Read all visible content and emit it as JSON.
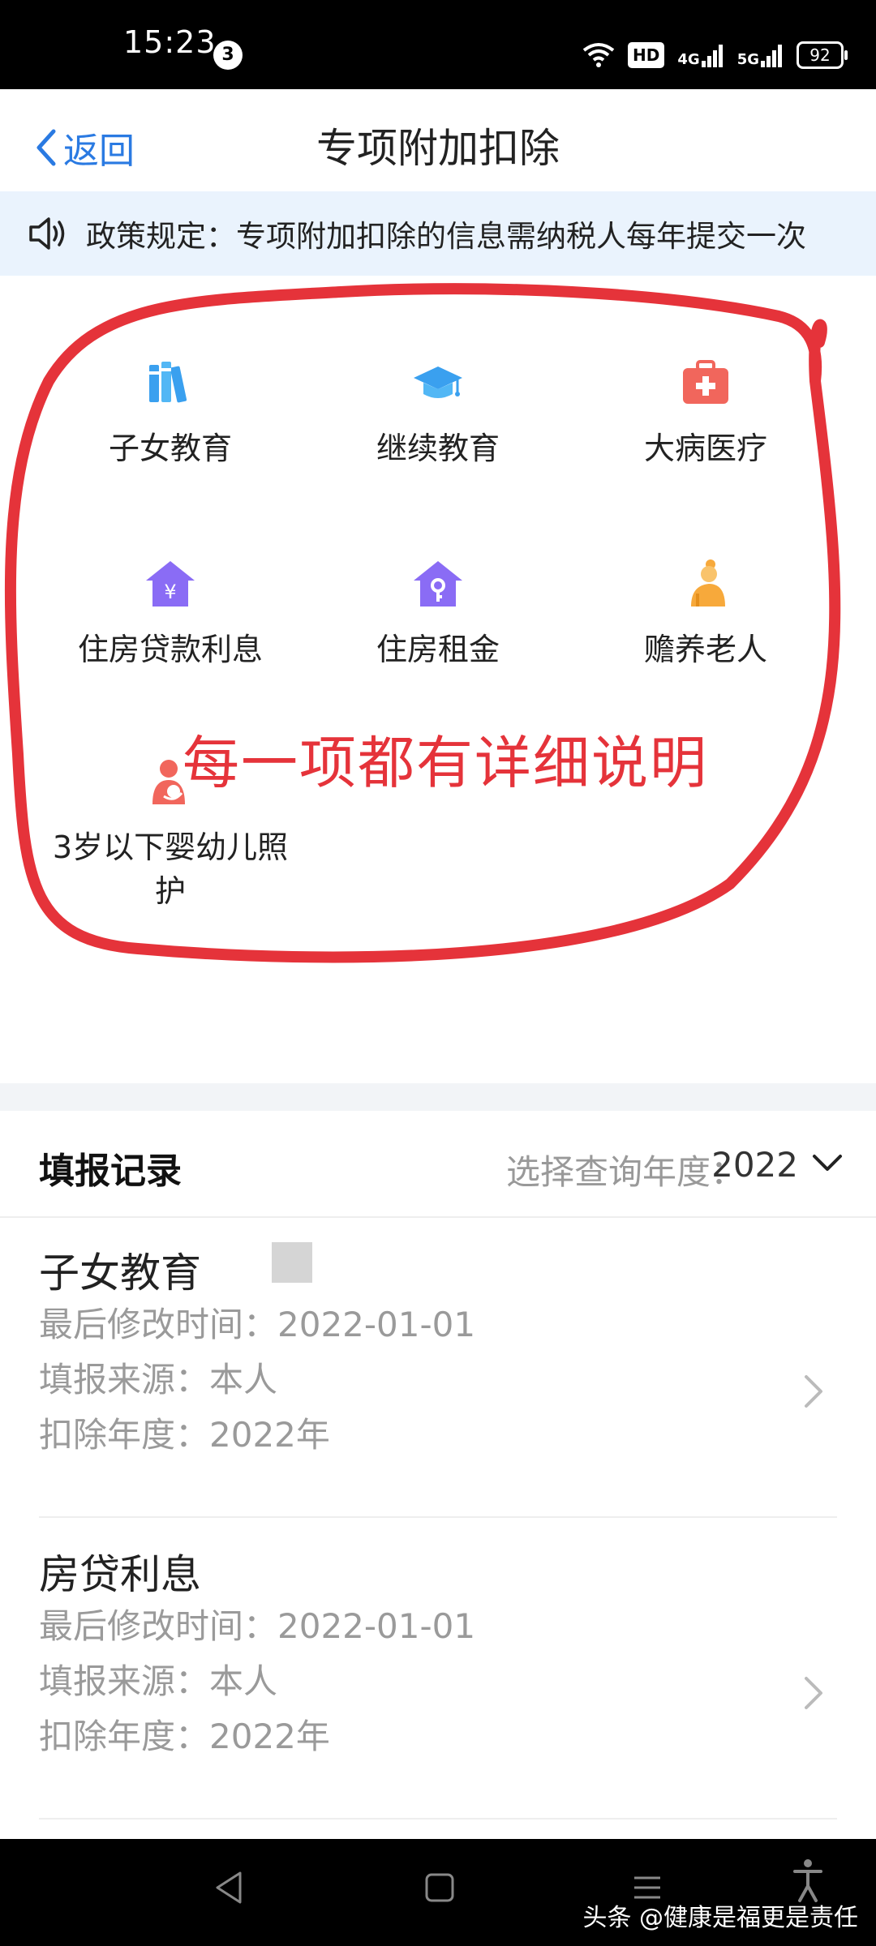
{
  "status_bar": {
    "time": "15:23",
    "notification_count": "3",
    "hd_label": "HD",
    "net1": "4G",
    "net2": "5G",
    "battery": "92"
  },
  "header": {
    "back_label": "返回",
    "title": "专项附加扣除"
  },
  "notice": {
    "text": "政策规定：专项附加扣除的信息需纳税人每年提交一次"
  },
  "categories": [
    {
      "label": "子女教育",
      "icon": "books-icon",
      "color": "#3aa0ef"
    },
    {
      "label": "继续教育",
      "icon": "graduation-cap-icon",
      "color": "#3aa0ef"
    },
    {
      "label": "大病医疗",
      "icon": "medical-kit-icon",
      "color": "#f1665c"
    },
    {
      "label": "住房贷款利息",
      "icon": "house-yuan-icon",
      "color": "#8a6cf5"
    },
    {
      "label": "住房租金",
      "icon": "house-key-icon",
      "color": "#8a6cf5"
    },
    {
      "label": "赡养老人",
      "icon": "elder-icon",
      "color": "#f7a93b"
    },
    {
      "label": "3岁以下婴幼儿照护",
      "icon": "mother-baby-icon",
      "color": "#f1665c"
    }
  ],
  "annotation": {
    "text": "每一项都有详细说明",
    "color": "#e5333a"
  },
  "records_header": {
    "title": "填报记录",
    "year_label": "选择查询年度：",
    "year_value": "2022"
  },
  "records": [
    {
      "name": "子女教育",
      "modified": "最后修改时间：2022-01-01",
      "source": "填报来源：本人",
      "year": "扣除年度：2022年"
    },
    {
      "name": "房贷利息",
      "modified": "最后修改时间：2022-01-01",
      "source": "填报来源：本人",
      "year": "扣除年度：2022年"
    }
  ],
  "watermark": "头条 @健康是福更是责任"
}
